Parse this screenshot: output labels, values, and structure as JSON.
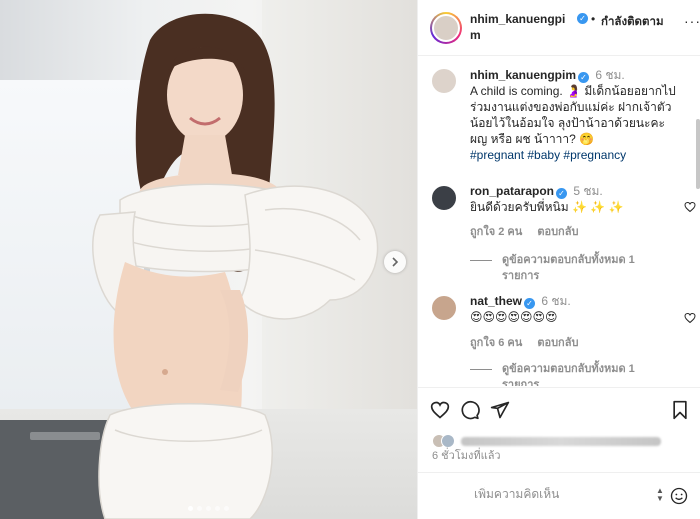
{
  "header": {
    "username": "nhim_kanuengpim",
    "separator": "•",
    "follow_label": "กำลังติดตาม",
    "more_label": "···"
  },
  "caption": {
    "username": "nhim_kanuengpim",
    "time": "6 ชม.",
    "text": "A child is coming. 🤰 มีเด็กน้อยอยากไปร่วมงานแต่งของพ่อกับแม่ค่ะ ฝากเจ้าตัวน้อยไว้ในอ้อมใจ ลุงป้าน้าอาด้วยนะคะ ผญ หรือ ผช น้าาาา? 🤭",
    "hashtags": "#pregnant #baby #pregnancy"
  },
  "comments": [
    {
      "username": "ron_patarapon",
      "time": "5 ชม.",
      "text": "ยินดีด้วยครับพี่หนิม ✨ ✨ ✨",
      "likes": "ถูกใจ 2 คน",
      "reply_label": "ตอบกลับ",
      "view_replies": "ดูข้อความตอบกลับทั้งหมด 1 รายการ"
    },
    {
      "username": "nat_thew",
      "time": "6 ชม.",
      "text": "😍😍😍😍😍😍😍",
      "likes": "ถูกใจ 6 คน",
      "reply_label": "ตอบกลับ",
      "view_replies": "ดูข้อความตอบกลับทั้งหมด 1 รายการ"
    }
  ],
  "post": {
    "time_ago": "6 ชั่วโมงที่แล้ว",
    "comment_placeholder": "เพิ่มความคิดเห็น",
    "carousel_slides": 5,
    "carousel_active": 1
  },
  "colors": {
    "verified": "#3897f0",
    "muted": "#8e8e8e",
    "hashtag": "#00376b"
  },
  "icons": [
    "verified-icon",
    "heart-icon",
    "comment-icon",
    "share-icon",
    "bookmark-icon",
    "emoji-icon",
    "chevron-right-icon"
  ]
}
